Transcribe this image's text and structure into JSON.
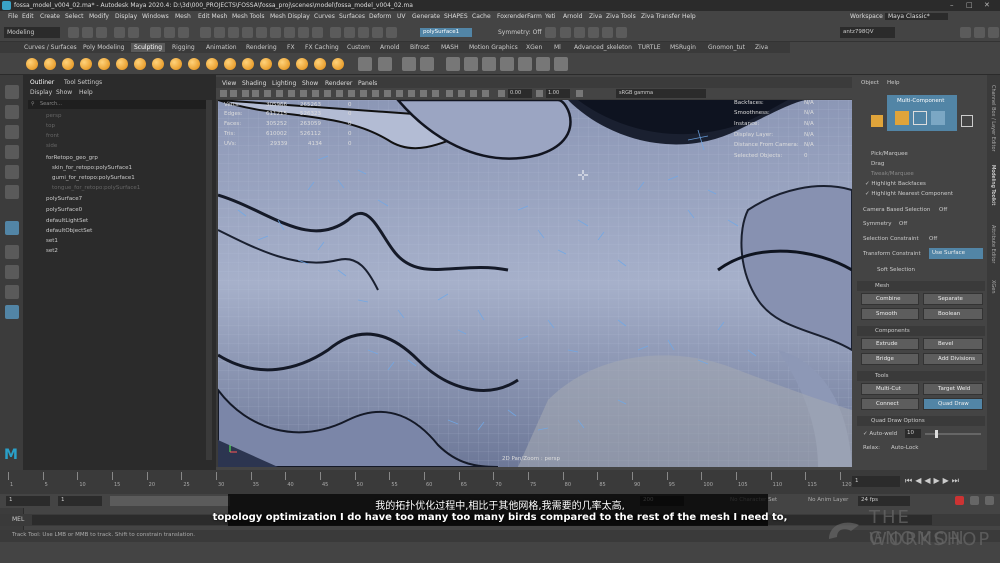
{
  "window": {
    "title": "fossa_model_v004_02.ma* - Autodesk Maya 2020.4: D:\\3d\\000_PROJECTS\\FOSSA\\fossa_proj\\scenes\\model\\fossa_model_v004_02.ma"
  },
  "menubar": {
    "items": [
      "File",
      "Edit",
      "Create",
      "Select",
      "Modify",
      "Display",
      "Windows",
      "Mesh",
      "Edit Mesh",
      "Mesh Tools",
      "Mesh Display",
      "Curves",
      "Surfaces",
      "Deform",
      "UV",
      "Generate",
      "SHAPES",
      "Cache",
      "FoxrenderFarm",
      "Yeti",
      "Arnold",
      "Ziva",
      "Ziva Tools",
      "Ziva Transfer",
      "Help"
    ],
    "workspace_label": "Workspace :",
    "workspace_value": "Maya Classic*"
  },
  "statusline": {
    "mode": "Modeling",
    "selected_object": "polySurface1",
    "symmetry": "Symmetry: Off",
    "user": "antz798QV"
  },
  "shelf": {
    "tabs": [
      "Curves / Surfaces",
      "Poly Modeling",
      "Sculpting",
      "Rigging",
      "Animation",
      "Rendering",
      "FX",
      "FX Caching",
      "Custom",
      "Arnold",
      "Bifrost",
      "MASH",
      "Motion Graphics",
      "XGen",
      "Ml",
      "Advanced_skeleton",
      "TURTLE",
      "MSRugin",
      "Gnomon_tut",
      "Ziva"
    ],
    "active_tab": "Sculpting"
  },
  "outliner": {
    "tabs": [
      "Outliner",
      "Tool Settings"
    ],
    "menu": [
      "Display",
      "Show",
      "Help"
    ],
    "search_placeholder": "Search...",
    "items": [
      "persp",
      "top",
      "front",
      "side",
      "forRetopo_geo_grp",
      "skin_for_retopo:polySurface1",
      "gumi_for_retopo:polySurface1",
      "tongue_for_retopo:polySurface1",
      "polySurface7",
      "polySurface0",
      "defaultLightSet",
      "defaultObjectSet",
      "set1",
      "set2"
    ]
  },
  "viewport": {
    "menu": [
      "View",
      "Shading",
      "Lighting",
      "Show",
      "Renderer",
      "Panels"
    ],
    "exposure": "0.00",
    "gamma": "1.00",
    "color_space": "sRGB gamma",
    "camera_label": "2D Pan/Zoom : persp",
    "hud_left": [
      {
        "label": "Verts:",
        "a": "305966",
        "b": "265263",
        "c": "0"
      },
      {
        "label": "Edges:",
        "a": "611215",
        "b": "526323",
        "c": "0"
      },
      {
        "label": "Faces:",
        "a": "305252",
        "b": "263059",
        "c": "0"
      },
      {
        "label": "Tris:",
        "a": "610002",
        "b": "526112",
        "c": "0"
      },
      {
        "label": "UVs:",
        "a": "29339",
        "b": "4134",
        "c": "0"
      }
    ],
    "hud_right": [
      {
        "label": "Backfaces:",
        "v": "N/A"
      },
      {
        "label": "Smoothness:",
        "v": "N/A"
      },
      {
        "label": "Instance:",
        "v": "N/A"
      },
      {
        "label": "Display Layer:",
        "v": "N/A"
      },
      {
        "label": "Distance From Camera:",
        "v": "N/A"
      },
      {
        "label": "Selected Objects:",
        "v": "0"
      }
    ]
  },
  "modeling_toolkit": {
    "tabs": [
      "Object",
      "Help"
    ],
    "multi_component": "Multi-Component",
    "pick_marquee": "Pick/Marquee",
    "drag": "Drag",
    "tweak_marquee": "Tweak/Marquee",
    "highlight_backfaces": "Highlight Backfaces",
    "highlight_nearest": "Highlight Nearest Component",
    "camera_based_selection": "Camera Based Selection",
    "camera_based_value": "Off",
    "symmetry": "Symmetry",
    "symmetry_value": "Off",
    "selection_constraint": "Selection Constraint",
    "selection_constraint_value": "Off",
    "transform_constraint": "Transform Constraint",
    "transform_constraint_value": "Use Surface",
    "soft_selection": "Soft Selection",
    "mesh_header": "Mesh",
    "combine": "Combine",
    "separate": "Separate",
    "smooth": "Smooth",
    "boolean": "Boolean",
    "components_header": "Components",
    "extrude": "Extrude",
    "bevel": "Bevel",
    "bridge": "Bridge",
    "add_divisions": "Add Divisions",
    "tools_header": "Tools",
    "multi_cut": "Multi-Cut",
    "target_weld": "Target Weld",
    "connect": "Connect",
    "quad_draw": "Quad Draw",
    "quad_draw_options": "Quad Draw Options",
    "auto_weld": "Auto-weld",
    "auto_weld_value": "10",
    "relax": "Relax:",
    "auto_lock": "Auto-Lock"
  },
  "side_tabs": [
    "Channel Box / Layer Editor",
    "Modeling Toolkit",
    "Attribute Editor",
    "XGen"
  ],
  "timeline": {
    "ticks": [
      "1",
      "5",
      "10",
      "15",
      "20",
      "25",
      "30",
      "35",
      "40",
      "45",
      "50",
      "55",
      "60",
      "65",
      "70",
      "75",
      "80",
      "85",
      "90",
      "95",
      "100",
      "105",
      "110",
      "115",
      "120"
    ],
    "current_frame": "1",
    "start": "1",
    "end": "1",
    "range_end": "200",
    "character_set": "No Character Set",
    "anim_layer": "No Anim Layer",
    "fps": "24 fps"
  },
  "mel": {
    "label": "MEL"
  },
  "helpline": {
    "text": "Track Tool: Use LMB or MMB to track. Shift to constrain translation."
  },
  "subtitles": {
    "zh": "我的拓扑优化过程中,相比于其他网格,我需要的几率太高,",
    "en": "topology optimization I do have too many too many birds compared to the rest of the mesh I need to,"
  },
  "watermark": {
    "line1": "THE GNOMON",
    "line2": "WORKSHOP"
  },
  "colors": {
    "accent_blue": "#5285a6",
    "ui_bg": "#444444",
    "panel_dark": "#2b2b2b"
  }
}
